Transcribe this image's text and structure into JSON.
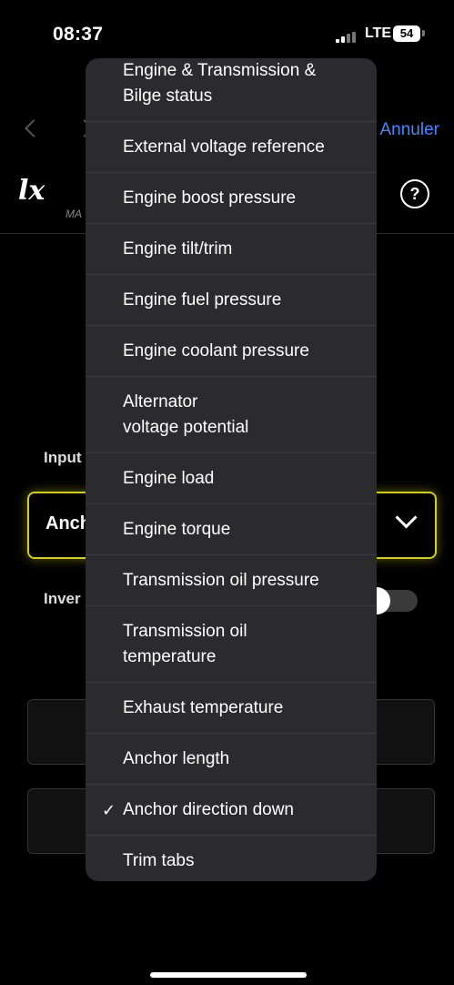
{
  "status_bar": {
    "time": "08:37",
    "network": "LTE",
    "battery": "54"
  },
  "nav": {
    "cancel_label": "Annuler"
  },
  "logo": {
    "text": "lx",
    "sub": "MA"
  },
  "form": {
    "input_label": "Input",
    "select_value": "Anch",
    "invert_label": "Inver"
  },
  "menu": {
    "items": [
      "Engine & Transmission &\nBilge status",
      "External voltage reference",
      "Engine boost pressure",
      "Engine tilt/trim",
      "Engine fuel pressure",
      "Engine coolant pressure",
      "Alternator\nvoltage potential",
      "Engine load",
      "Engine torque",
      "Transmission oil pressure",
      "Transmission oil\ntemperature",
      "Exhaust temperature",
      "Anchor length",
      "Anchor direction down",
      "Trim tabs"
    ],
    "selected_item": "Anchor direction down",
    "check": "✓"
  },
  "colors": {
    "accent_yellow": "#d4d100",
    "link_blue": "#3f8bff",
    "menu_bg": "#2b2b2d"
  }
}
